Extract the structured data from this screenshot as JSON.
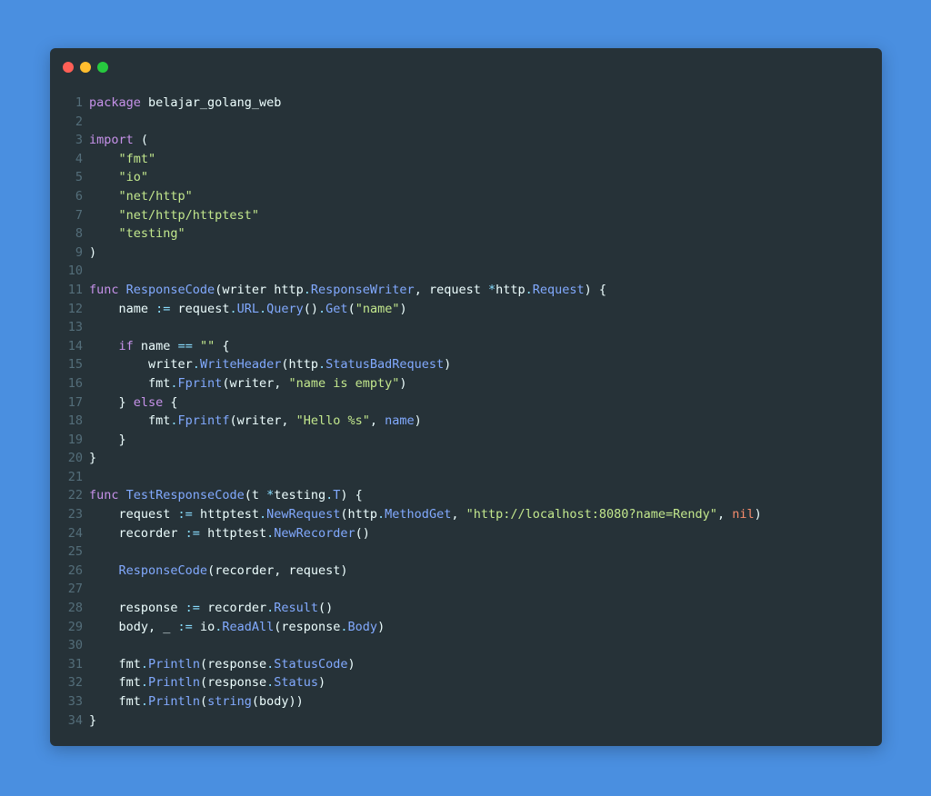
{
  "window": {
    "controls": [
      "close",
      "minimize",
      "maximize"
    ]
  },
  "colors": {
    "background": "#4a8fe0",
    "editor": "#263238",
    "keyword": "#c792ea",
    "function": "#82aaff",
    "string": "#c3e88d",
    "nil": "#f78c6c",
    "line_number": "#546e7a"
  },
  "code": [
    {
      "n": "1",
      "t": [
        [
          "kw",
          "package"
        ],
        [
          "id",
          " belajar_golang_web"
        ]
      ]
    },
    {
      "n": "2",
      "t": []
    },
    {
      "n": "3",
      "t": [
        [
          "kw",
          "import"
        ],
        [
          "id",
          " ("
        ]
      ]
    },
    {
      "n": "4",
      "t": [
        [
          "id",
          "    "
        ],
        [
          "str",
          "\"fmt\""
        ]
      ]
    },
    {
      "n": "5",
      "t": [
        [
          "id",
          "    "
        ],
        [
          "str",
          "\"io\""
        ]
      ]
    },
    {
      "n": "6",
      "t": [
        [
          "id",
          "    "
        ],
        [
          "str",
          "\"net/http\""
        ]
      ]
    },
    {
      "n": "7",
      "t": [
        [
          "id",
          "    "
        ],
        [
          "str",
          "\"net/http/httptest\""
        ]
      ]
    },
    {
      "n": "8",
      "t": [
        [
          "id",
          "    "
        ],
        [
          "str",
          "\"testing\""
        ]
      ]
    },
    {
      "n": "9",
      "t": [
        [
          "id",
          ")"
        ]
      ]
    },
    {
      "n": "10",
      "t": []
    },
    {
      "n": "11",
      "t": [
        [
          "kw",
          "func"
        ],
        [
          "id",
          " "
        ],
        [
          "fn",
          "ResponseCode"
        ],
        [
          "id",
          "(writer http"
        ],
        [
          "pun",
          "."
        ],
        [
          "fn",
          "ResponseWriter"
        ],
        [
          "id",
          ", request "
        ],
        [
          "pun",
          "*"
        ],
        [
          "id",
          "http"
        ],
        [
          "pun",
          "."
        ],
        [
          "fn",
          "Request"
        ],
        [
          "id",
          ") {"
        ]
      ]
    },
    {
      "n": "12",
      "t": [
        [
          "id",
          "    name "
        ],
        [
          "pun",
          ":="
        ],
        [
          "id",
          " request"
        ],
        [
          "pun",
          "."
        ],
        [
          "fn",
          "URL"
        ],
        [
          "pun",
          "."
        ],
        [
          "fn",
          "Query"
        ],
        [
          "id",
          "()"
        ],
        [
          "pun",
          "."
        ],
        [
          "fn",
          "Get"
        ],
        [
          "id",
          "("
        ],
        [
          "str",
          "\"name\""
        ],
        [
          "id",
          ")"
        ]
      ]
    },
    {
      "n": "13",
      "t": []
    },
    {
      "n": "14",
      "t": [
        [
          "id",
          "    "
        ],
        [
          "kw",
          "if"
        ],
        [
          "id",
          " name "
        ],
        [
          "pun",
          "=="
        ],
        [
          "id",
          " "
        ],
        [
          "str",
          "\"\""
        ],
        [
          "id",
          " {"
        ]
      ]
    },
    {
      "n": "15",
      "t": [
        [
          "id",
          "        writer"
        ],
        [
          "pun",
          "."
        ],
        [
          "fn",
          "WriteHeader"
        ],
        [
          "id",
          "(http"
        ],
        [
          "pun",
          "."
        ],
        [
          "fn",
          "StatusBadRequest"
        ],
        [
          "id",
          ")"
        ]
      ]
    },
    {
      "n": "16",
      "t": [
        [
          "id",
          "        fmt"
        ],
        [
          "pun",
          "."
        ],
        [
          "fn",
          "Fprint"
        ],
        [
          "id",
          "(writer, "
        ],
        [
          "str",
          "\"name is empty\""
        ],
        [
          "id",
          ")"
        ]
      ]
    },
    {
      "n": "17",
      "t": [
        [
          "id",
          "    } "
        ],
        [
          "kw",
          "else"
        ],
        [
          "id",
          " {"
        ]
      ]
    },
    {
      "n": "18",
      "t": [
        [
          "id",
          "        fmt"
        ],
        [
          "pun",
          "."
        ],
        [
          "fn",
          "Fprintf"
        ],
        [
          "id",
          "(writer, "
        ],
        [
          "str",
          "\"Hello %s\""
        ],
        [
          "id",
          ", "
        ],
        [
          "fn",
          "name"
        ],
        [
          "id",
          ")"
        ]
      ]
    },
    {
      "n": "19",
      "t": [
        [
          "id",
          "    }"
        ]
      ]
    },
    {
      "n": "20",
      "t": [
        [
          "id",
          "}"
        ]
      ]
    },
    {
      "n": "21",
      "t": []
    },
    {
      "n": "22",
      "t": [
        [
          "kw",
          "func"
        ],
        [
          "id",
          " "
        ],
        [
          "fn",
          "TestResponseCode"
        ],
        [
          "id",
          "(t "
        ],
        [
          "pun",
          "*"
        ],
        [
          "id",
          "testing"
        ],
        [
          "pun",
          "."
        ],
        [
          "fn",
          "T"
        ],
        [
          "id",
          ") {"
        ]
      ]
    },
    {
      "n": "23",
      "t": [
        [
          "id",
          "    request "
        ],
        [
          "pun",
          ":="
        ],
        [
          "id",
          " httptest"
        ],
        [
          "pun",
          "."
        ],
        [
          "fn",
          "NewRequest"
        ],
        [
          "id",
          "(http"
        ],
        [
          "pun",
          "."
        ],
        [
          "fn",
          "MethodGet"
        ],
        [
          "id",
          ", "
        ],
        [
          "str",
          "\"http://localhost:8080?name=Rendy\""
        ],
        [
          "id",
          ", "
        ],
        [
          "nil",
          "nil"
        ],
        [
          "id",
          ")"
        ]
      ]
    },
    {
      "n": "24",
      "t": [
        [
          "id",
          "    recorder "
        ],
        [
          "pun",
          ":="
        ],
        [
          "id",
          " httptest"
        ],
        [
          "pun",
          "."
        ],
        [
          "fn",
          "NewRecorder"
        ],
        [
          "id",
          "()"
        ]
      ]
    },
    {
      "n": "25",
      "t": []
    },
    {
      "n": "26",
      "t": [
        [
          "id",
          "    "
        ],
        [
          "fn",
          "ResponseCode"
        ],
        [
          "id",
          "(recorder, request)"
        ]
      ]
    },
    {
      "n": "27",
      "t": []
    },
    {
      "n": "28",
      "t": [
        [
          "id",
          "    response "
        ],
        [
          "pun",
          ":="
        ],
        [
          "id",
          " recorder"
        ],
        [
          "pun",
          "."
        ],
        [
          "fn",
          "Result"
        ],
        [
          "id",
          "()"
        ]
      ]
    },
    {
      "n": "29",
      "t": [
        [
          "id",
          "    body, _ "
        ],
        [
          "pun",
          ":="
        ],
        [
          "id",
          " io"
        ],
        [
          "pun",
          "."
        ],
        [
          "fn",
          "ReadAll"
        ],
        [
          "id",
          "(response"
        ],
        [
          "pun",
          "."
        ],
        [
          "fn",
          "Body"
        ],
        [
          "id",
          ")"
        ]
      ]
    },
    {
      "n": "30",
      "t": []
    },
    {
      "n": "31",
      "t": [
        [
          "id",
          "    fmt"
        ],
        [
          "pun",
          "."
        ],
        [
          "fn",
          "Println"
        ],
        [
          "id",
          "(response"
        ],
        [
          "pun",
          "."
        ],
        [
          "fn",
          "StatusCode"
        ],
        [
          "id",
          ")"
        ]
      ]
    },
    {
      "n": "32",
      "t": [
        [
          "id",
          "    fmt"
        ],
        [
          "pun",
          "."
        ],
        [
          "fn",
          "Println"
        ],
        [
          "id",
          "(response"
        ],
        [
          "pun",
          "."
        ],
        [
          "fn",
          "Status"
        ],
        [
          "id",
          ")"
        ]
      ]
    },
    {
      "n": "33",
      "t": [
        [
          "id",
          "    fmt"
        ],
        [
          "pun",
          "."
        ],
        [
          "fn",
          "Println"
        ],
        [
          "id",
          "("
        ],
        [
          "fn",
          "string"
        ],
        [
          "id",
          "(body))"
        ]
      ]
    },
    {
      "n": "34",
      "t": [
        [
          "id",
          "}"
        ]
      ]
    }
  ]
}
